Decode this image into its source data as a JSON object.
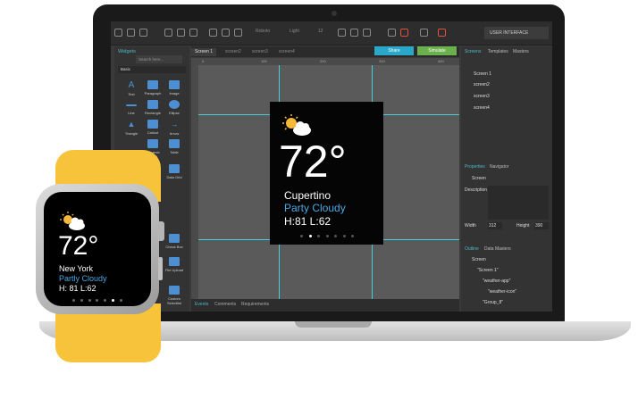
{
  "toolbar": {
    "view_label": "USER INTERFACE",
    "font": "Roboto",
    "weight": "Light",
    "size": "12"
  },
  "widgets": {
    "title": "Widgets",
    "search_placeholder": "Search here...",
    "category": "Basic",
    "items": [
      "Text",
      "Paragraph",
      "Image",
      "Line",
      "Rectangle",
      "Ellipse",
      "Triangle",
      "Callout",
      "Arrow",
      "",
      "Dynamic Panel",
      "Table",
      "",
      "Data List",
      "Data Grid",
      "",
      "Check Box",
      "File Upload",
      "Custom Selectlist"
    ]
  },
  "canvas": {
    "tabs": [
      "Screen 1",
      "screen2",
      "screen3",
      "screen4"
    ],
    "share": "Share",
    "simulate": "Simulate",
    "ruler_marks": [
      "0",
      "100",
      "200",
      "300",
      "400"
    ],
    "bottom_tabs": [
      "Events",
      "Comments",
      "Requirements"
    ]
  },
  "design_watch": {
    "temp": "72°",
    "city": "Cupertino",
    "condition": "Party Cloudy",
    "hilo": "H:81  L:62"
  },
  "right_panel": {
    "tabs": [
      "Screens",
      "Templates",
      "Masters"
    ],
    "screens": [
      "Screen 1",
      "screen2",
      "screen3",
      "screen4"
    ],
    "props_tabs": [
      "Properties",
      "Navigator"
    ],
    "screen_label": "Screen",
    "description_label": "Description",
    "width_label": "Width",
    "width_value": "312",
    "height_label": "Height",
    "height_value": "390",
    "outline_tabs": [
      "Outline",
      "Data Masters"
    ],
    "outline_root": "Screen",
    "outline_items": [
      "\"Screen 1\"",
      "\"weather-app\"",
      "\"weather-icon\"",
      "\"Group_8\"",
      "\"Group_7\"",
      "\"Text_83\""
    ]
  },
  "real_watch": {
    "temp": "72°",
    "city": "New York",
    "condition": "Partly Cloudy",
    "hilo": "H: 81  L:62"
  },
  "colors": {
    "accent": "#3fd0d8",
    "blue_text": "#49a9e6",
    "band": "#f6c33b",
    "share": "#2aa8c9",
    "simulate": "#6ab04c"
  }
}
